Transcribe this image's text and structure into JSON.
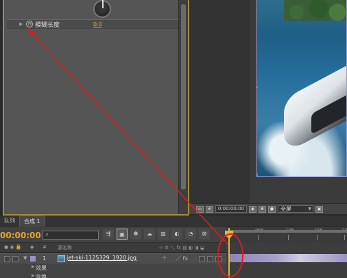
{
  "effects": {
    "property_name": "模糊长度",
    "property_value": "0.0"
  },
  "viewer": {
    "timecode": "0:00:00:00",
    "zoom_dropdown": "全屏"
  },
  "tabs": [
    {
      "label": "队列"
    },
    {
      "label": "合成 1"
    }
  ],
  "timeline": {
    "current_time": "00:00:00",
    "search_icon": "magnifier",
    "search_placeholder": "",
    "ruler_labels": [
      "05f",
      "10f",
      "15f",
      "20f"
    ],
    "columns": {
      "number": "#",
      "source_name": "源名称"
    },
    "layer": {
      "index": "1",
      "name": "jet-ski-1125329_1920.jpg"
    },
    "sub_items": [
      "效果",
      "变换"
    ]
  },
  "annotation": {
    "arrow_color": "#d42020",
    "circle_color": "#d42020"
  },
  "colors": {
    "timecode": "#e3a52a",
    "cti": "#e6b82d",
    "label": "#9b8fc8",
    "panel_border": "#a38a3c"
  }
}
